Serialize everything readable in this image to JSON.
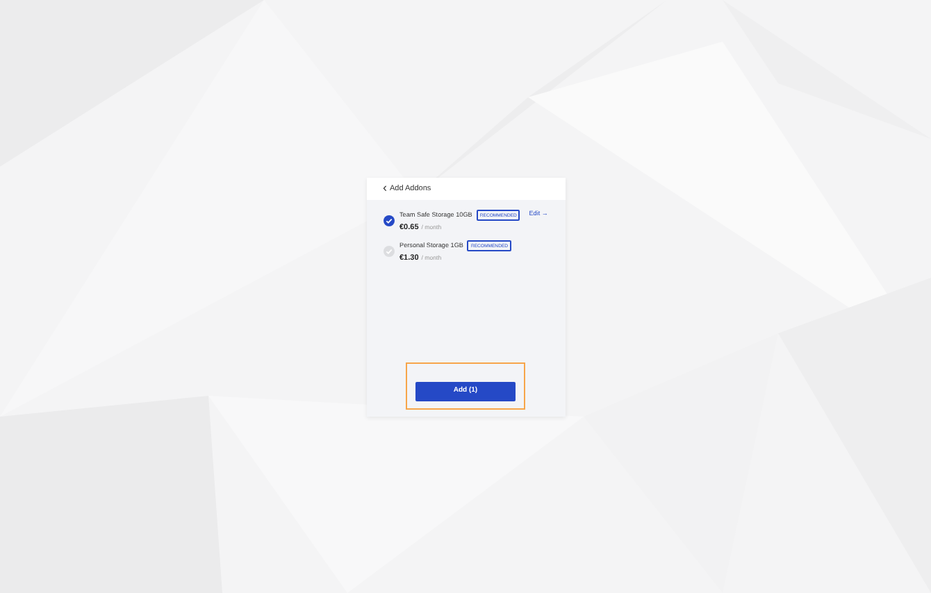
{
  "header": {
    "back_icon": "‹",
    "title": "Add Addons"
  },
  "addons": [
    {
      "name": "Team Safe Storage 10GB",
      "badge": "RECOMMENDED",
      "price": "€0.65",
      "period": "/ month",
      "checked": true,
      "action": "Edit →"
    },
    {
      "name": "Personal Storage 1GB",
      "badge": "RECOMMENDED",
      "price": "€1.30",
      "period": "/ month",
      "checked": false
    }
  ],
  "footer": {
    "button": "Add (1)",
    "highlighted": true
  }
}
